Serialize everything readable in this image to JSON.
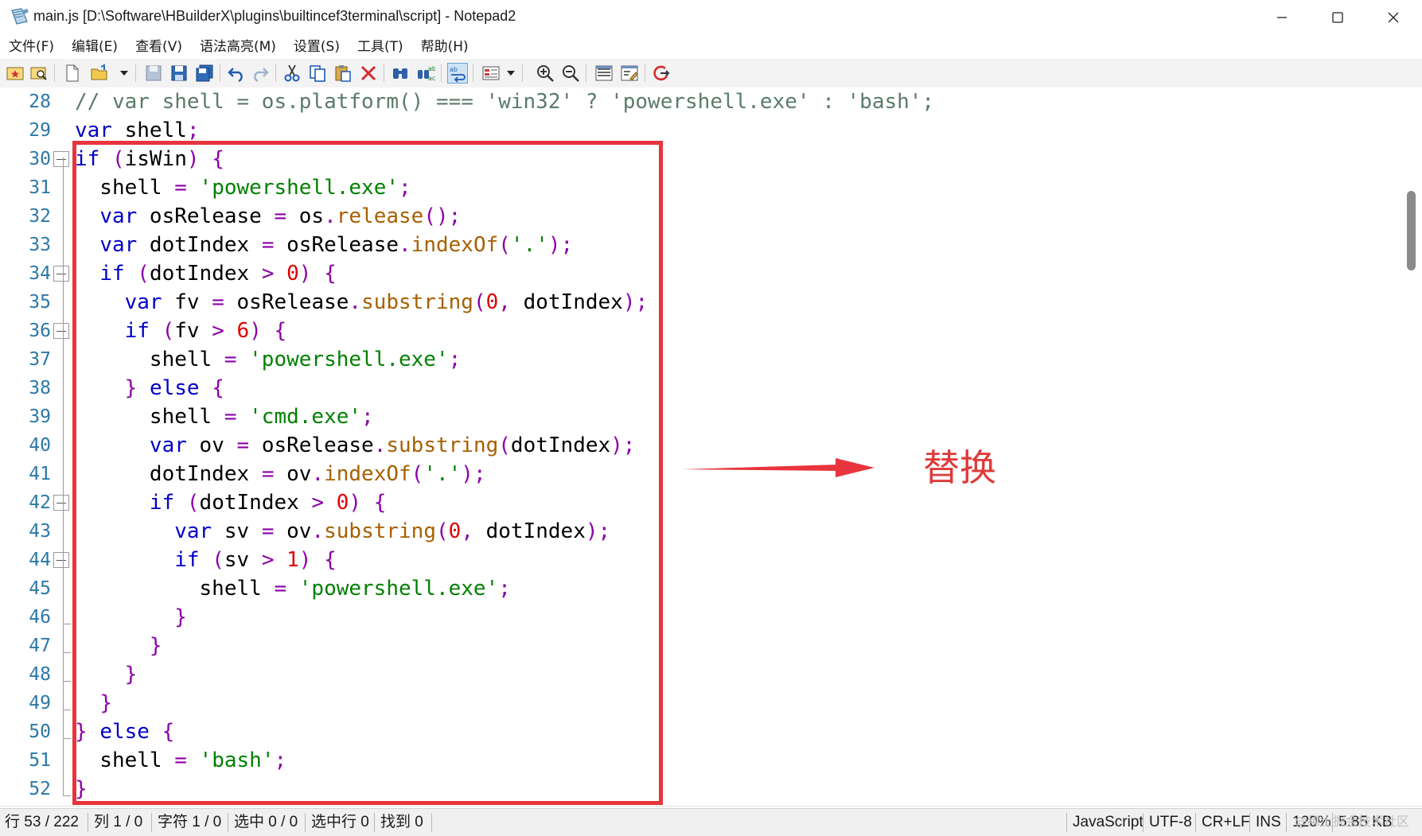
{
  "window": {
    "title": "main.js [D:\\Software\\HBuilderX\\plugins\\builtincef3terminal\\script] - Notepad2"
  },
  "menu": {
    "items": [
      "文件(F)",
      "编辑(E)",
      "查看(V)",
      "语法高亮(M)",
      "设置(S)",
      "工具(T)",
      "帮助(H)"
    ]
  },
  "toolbar": {
    "icons": [
      "favorites-icon",
      "browse-icon",
      "new-file-icon",
      "open-file-icon",
      "save-icon",
      "save-as-icon",
      "save-copy-icon",
      "undo-icon",
      "redo-icon",
      "cut-icon",
      "copy-icon",
      "paste-icon",
      "delete-icon",
      "find-icon",
      "replace-icon",
      "word-wrap-icon",
      "view-options-icon",
      "zoom-in-icon",
      "zoom-out-icon",
      "settings-icon",
      "scheme-icon",
      "exit-icon"
    ]
  },
  "editor": {
    "lines": [
      {
        "num": "28",
        "tokens": [
          [
            "c",
            "// var shell = os.platform() === 'win32' ? 'powershell.exe' : 'bash';"
          ]
        ]
      },
      {
        "num": "29",
        "tokens": [
          [
            "k",
            "var"
          ],
          [
            "t",
            " shell"
          ],
          [
            "p",
            ";"
          ]
        ]
      },
      {
        "num": "30",
        "tokens": [
          [
            "k",
            "if"
          ],
          [
            "t",
            " "
          ],
          [
            "p",
            "("
          ],
          [
            "t",
            "isWin"
          ],
          [
            "p",
            ")"
          ],
          [
            "t",
            " "
          ],
          [
            "p",
            "{"
          ]
        ]
      },
      {
        "num": "31",
        "tokens": [
          [
            "t",
            "  shell "
          ],
          [
            "p",
            "="
          ],
          [
            "t",
            " "
          ],
          [
            "s",
            "'powershell.exe'"
          ],
          [
            "p",
            ";"
          ]
        ]
      },
      {
        "num": "32",
        "tokens": [
          [
            "t",
            "  "
          ],
          [
            "k",
            "var"
          ],
          [
            "t",
            " osRelease "
          ],
          [
            "p",
            "="
          ],
          [
            "t",
            " os"
          ],
          [
            "p",
            "."
          ],
          [
            "f",
            "release"
          ],
          [
            "p",
            "();"
          ]
        ]
      },
      {
        "num": "33",
        "tokens": [
          [
            "t",
            "  "
          ],
          [
            "k",
            "var"
          ],
          [
            "t",
            " dotIndex "
          ],
          [
            "p",
            "="
          ],
          [
            "t",
            " osRelease"
          ],
          [
            "p",
            "."
          ],
          [
            "f",
            "indexOf"
          ],
          [
            "p",
            "("
          ],
          [
            "s",
            "'.'"
          ],
          [
            "p",
            ");"
          ]
        ]
      },
      {
        "num": "34",
        "tokens": [
          [
            "t",
            "  "
          ],
          [
            "k",
            "if"
          ],
          [
            "t",
            " "
          ],
          [
            "p",
            "("
          ],
          [
            "t",
            "dotIndex "
          ],
          [
            "p",
            ">"
          ],
          [
            "t",
            " "
          ],
          [
            "n",
            "0"
          ],
          [
            "p",
            ")"
          ],
          [
            "t",
            " "
          ],
          [
            "p",
            "{"
          ]
        ]
      },
      {
        "num": "35",
        "tokens": [
          [
            "t",
            "    "
          ],
          [
            "k",
            "var"
          ],
          [
            "t",
            " fv "
          ],
          [
            "p",
            "="
          ],
          [
            "t",
            " osRelease"
          ],
          [
            "p",
            "."
          ],
          [
            "f",
            "substring"
          ],
          [
            "p",
            "("
          ],
          [
            "n",
            "0"
          ],
          [
            "p",
            ","
          ],
          [
            "t",
            " dotIndex"
          ],
          [
            "p",
            ");"
          ]
        ]
      },
      {
        "num": "36",
        "tokens": [
          [
            "t",
            "    "
          ],
          [
            "k",
            "if"
          ],
          [
            "t",
            " "
          ],
          [
            "p",
            "("
          ],
          [
            "t",
            "fv "
          ],
          [
            "p",
            ">"
          ],
          [
            "t",
            " "
          ],
          [
            "n",
            "6"
          ],
          [
            "p",
            ")"
          ],
          [
            "t",
            " "
          ],
          [
            "p",
            "{"
          ]
        ]
      },
      {
        "num": "37",
        "tokens": [
          [
            "t",
            "      shell "
          ],
          [
            "p",
            "="
          ],
          [
            "t",
            " "
          ],
          [
            "s",
            "'powershell.exe'"
          ],
          [
            "p",
            ";"
          ]
        ]
      },
      {
        "num": "38",
        "tokens": [
          [
            "t",
            "    "
          ],
          [
            "p",
            "}"
          ],
          [
            "t",
            " "
          ],
          [
            "k",
            "else"
          ],
          [
            "t",
            " "
          ],
          [
            "p",
            "{"
          ]
        ]
      },
      {
        "num": "39",
        "tokens": [
          [
            "t",
            "      shell "
          ],
          [
            "p",
            "="
          ],
          [
            "t",
            " "
          ],
          [
            "s",
            "'cmd.exe'"
          ],
          [
            "p",
            ";"
          ]
        ]
      },
      {
        "num": "40",
        "tokens": [
          [
            "t",
            "      "
          ],
          [
            "k",
            "var"
          ],
          [
            "t",
            " ov "
          ],
          [
            "p",
            "="
          ],
          [
            "t",
            " osRelease"
          ],
          [
            "p",
            "."
          ],
          [
            "f",
            "substring"
          ],
          [
            "p",
            "("
          ],
          [
            "t",
            "dotIndex"
          ],
          [
            "p",
            ");"
          ]
        ]
      },
      {
        "num": "41",
        "tokens": [
          [
            "t",
            "      dotIndex "
          ],
          [
            "p",
            "="
          ],
          [
            "t",
            " ov"
          ],
          [
            "p",
            "."
          ],
          [
            "f",
            "indexOf"
          ],
          [
            "p",
            "("
          ],
          [
            "s",
            "'.'"
          ],
          [
            "p",
            ");"
          ]
        ]
      },
      {
        "num": "42",
        "tokens": [
          [
            "t",
            "      "
          ],
          [
            "k",
            "if"
          ],
          [
            "t",
            " "
          ],
          [
            "p",
            "("
          ],
          [
            "t",
            "dotIndex "
          ],
          [
            "p",
            ">"
          ],
          [
            "t",
            " "
          ],
          [
            "n",
            "0"
          ],
          [
            "p",
            ")"
          ],
          [
            "t",
            " "
          ],
          [
            "p",
            "{"
          ]
        ]
      },
      {
        "num": "43",
        "tokens": [
          [
            "t",
            "        "
          ],
          [
            "k",
            "var"
          ],
          [
            "t",
            " sv "
          ],
          [
            "p",
            "="
          ],
          [
            "t",
            " ov"
          ],
          [
            "p",
            "."
          ],
          [
            "f",
            "substring"
          ],
          [
            "p",
            "("
          ],
          [
            "n",
            "0"
          ],
          [
            "p",
            ","
          ],
          [
            "t",
            " dotIndex"
          ],
          [
            "p",
            ");"
          ]
        ]
      },
      {
        "num": "44",
        "tokens": [
          [
            "t",
            "        "
          ],
          [
            "k",
            "if"
          ],
          [
            "t",
            " "
          ],
          [
            "p",
            "("
          ],
          [
            "t",
            "sv "
          ],
          [
            "p",
            ">"
          ],
          [
            "t",
            " "
          ],
          [
            "n",
            "1"
          ],
          [
            "p",
            ")"
          ],
          [
            "t",
            " "
          ],
          [
            "p",
            "{"
          ]
        ]
      },
      {
        "num": "45",
        "tokens": [
          [
            "t",
            "          shell "
          ],
          [
            "p",
            "="
          ],
          [
            "t",
            " "
          ],
          [
            "s",
            "'powershell.exe'"
          ],
          [
            "p",
            ";"
          ]
        ]
      },
      {
        "num": "46",
        "tokens": [
          [
            "t",
            "        "
          ],
          [
            "p",
            "}"
          ]
        ]
      },
      {
        "num": "47",
        "tokens": [
          [
            "t",
            "      "
          ],
          [
            "p",
            "}"
          ]
        ]
      },
      {
        "num": "48",
        "tokens": [
          [
            "t",
            "    "
          ],
          [
            "p",
            "}"
          ]
        ]
      },
      {
        "num": "49",
        "tokens": [
          [
            "t",
            "  "
          ],
          [
            "p",
            "}"
          ]
        ]
      },
      {
        "num": "50",
        "tokens": [
          [
            "p",
            "}"
          ],
          [
            "t",
            " "
          ],
          [
            "k",
            "else"
          ],
          [
            "t",
            " "
          ],
          [
            "p",
            "{"
          ]
        ]
      },
      {
        "num": "51",
        "tokens": [
          [
            "t",
            "  shell "
          ],
          [
            "p",
            "="
          ],
          [
            "t",
            " "
          ],
          [
            "s",
            "'bash'"
          ],
          [
            "p",
            ";"
          ]
        ]
      },
      {
        "num": "52",
        "tokens": [
          [
            "p",
            "}"
          ]
        ]
      }
    ]
  },
  "annotation": {
    "label": "替换",
    "color": "#e8343c"
  },
  "status": {
    "line": "行 53 / 222",
    "col": "列 1 / 0",
    "char": "字符 1 / 0",
    "sel": "选中 0 / 0",
    "sel_lines": "选中行 0",
    "found": "找到 0",
    "lang": "JavaScript",
    "encoding": "UTF-8",
    "eol": "CR+LF",
    "mode": "INS",
    "zoom": "120%",
    "size": "5.85 KB"
  },
  "watermark": "@稀土掘金技术社区"
}
